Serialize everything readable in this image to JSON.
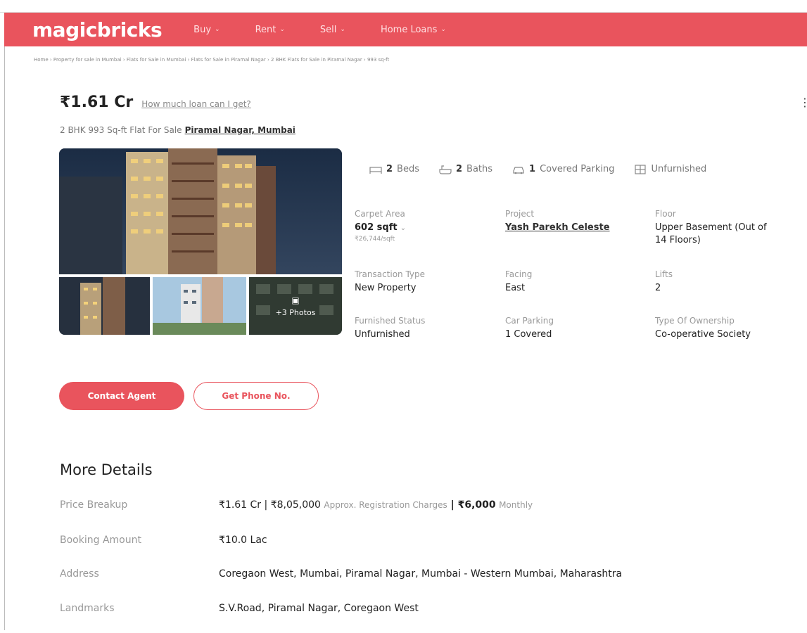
{
  "header": {
    "logo": "magicbricks",
    "nav": [
      {
        "label": "Buy"
      },
      {
        "label": "Rent"
      },
      {
        "label": "Sell"
      },
      {
        "label": "Home Loans"
      }
    ],
    "brand_color": "#e9545d"
  },
  "breadcrumb": "Home › Property for sale in Mumbai › Flats for Sale in Mumbai › Flats for Sale in Piramal Nagar › 2 BHK Flats for Sale in Piramal Nagar › 993 sq-ft",
  "listing": {
    "price": "₹1.61 Cr",
    "loan_link": "How much loan can I get?",
    "subtitle": "2 BHK 993 Sq-ft Flat For Sale",
    "location": "Piramal Nagar, Mumbai",
    "more_photos": "+3 Photos"
  },
  "amenities": [
    {
      "icon": "bed-icon",
      "count": "2",
      "label": "Beds"
    },
    {
      "icon": "bath-icon",
      "count": "2",
      "label": "Baths"
    },
    {
      "icon": "car-icon",
      "count": "1",
      "label": "Covered Parking"
    },
    {
      "icon": "furniture-icon",
      "count": "",
      "label": "Unfurnished"
    }
  ],
  "specs": {
    "carpet_area": {
      "label": "Carpet Area",
      "value": "602 sqft",
      "sub": "₹26,744/sqft"
    },
    "project": {
      "label": "Project",
      "value": "Yash Parekh Celeste"
    },
    "floor": {
      "label": "Floor",
      "value": "Upper Basement (Out of",
      "value2": "14 Floors)"
    },
    "transaction": {
      "label": "Transaction Type",
      "value": "New Property"
    },
    "facing": {
      "label": "Facing",
      "value": "East"
    },
    "lifts": {
      "label": "Lifts",
      "value": "2"
    },
    "furnished": {
      "label": "Furnished Status",
      "value": "Unfurnished"
    },
    "car_parking": {
      "label": "Car Parking",
      "value": "1 Covered"
    },
    "ownership": {
      "label": "Type Of Ownership",
      "value": "Co-operative Society"
    }
  },
  "actions": {
    "contact": "Contact Agent",
    "phone": "Get Phone No."
  },
  "more_details": {
    "title": "More Details",
    "price_breakup": {
      "label": "Price Breakup",
      "price": "₹1.61 Cr",
      "registration": "₹8,05,000",
      "registration_note": "Approx. Registration Charges",
      "monthly": "₹6,000",
      "monthly_note": "Monthly"
    },
    "booking": {
      "label": "Booking Amount",
      "value": "₹10.0 Lac"
    },
    "address": {
      "label": "Address",
      "value": "Coregaon West, Mumbai, Piramal Nagar, Mumbai - Western Mumbai, Maharashtra"
    },
    "landmarks": {
      "label": "Landmarks",
      "value": "S.V.Road, Piramal Nagar, Coregaon West"
    }
  }
}
